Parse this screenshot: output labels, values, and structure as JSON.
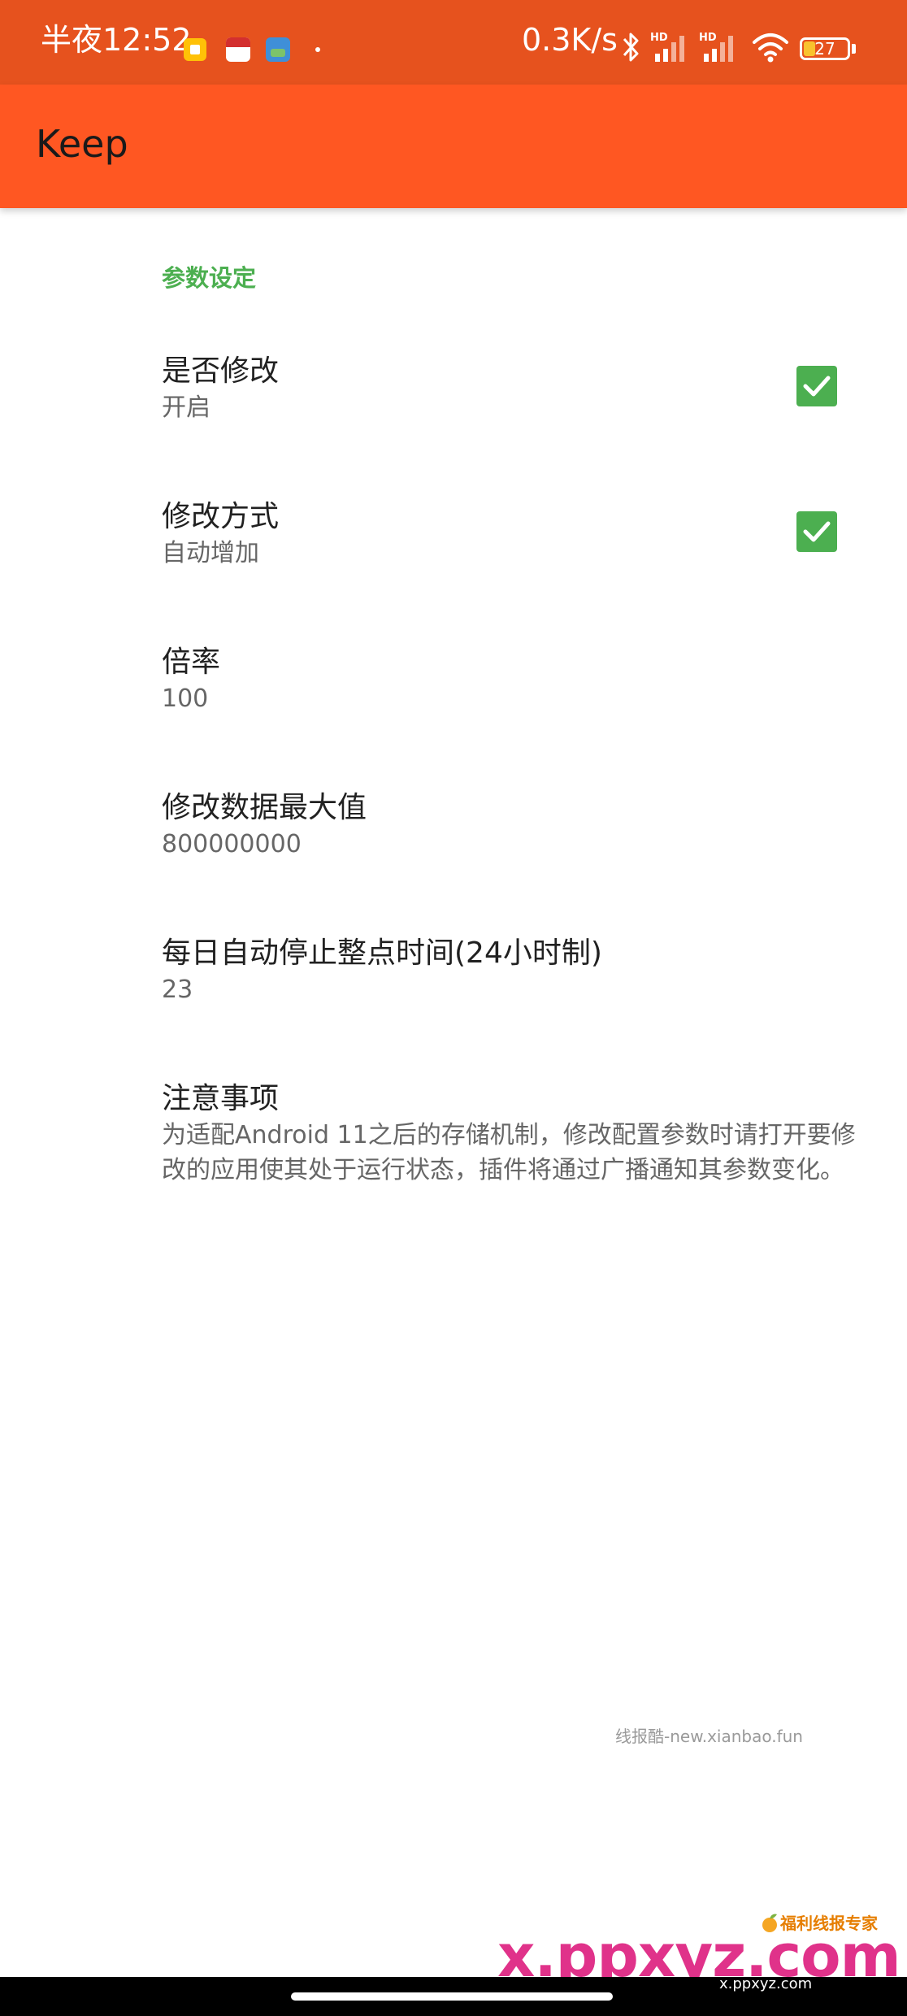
{
  "status_bar": {
    "time": "半夜12:52",
    "net_speed": "0.3K/s",
    "battery_level": "27",
    "battery_fraction": 0.27,
    "icons": [
      "bluetooth-icon",
      "hd-signal-icon",
      "hd-signal-icon",
      "wifi-icon",
      "battery-icon"
    ]
  },
  "app_bar": {
    "title": "Keep",
    "color": "#FF5722",
    "status_color": "#E6521E"
  },
  "preferences": {
    "category": "参数设定",
    "accent": "#4CAF50",
    "items": [
      {
        "title": "是否修改",
        "summary": "开启",
        "checked": true
      },
      {
        "title": "修改方式",
        "summary": "自动增加",
        "checked": true
      },
      {
        "title": "倍率",
        "summary": "100"
      },
      {
        "title": "修改数据最大值",
        "summary": "800000000"
      },
      {
        "title": "每日自动停止整点时间(24小时制)",
        "summary": "23"
      },
      {
        "title": "注意事项",
        "summary": "为适配Android 11之后的存储机制，修改配置参数时请打开要修改的应用使其处于运行状态，插件将通过广播通知其参数变化。"
      }
    ]
  },
  "watermarks": {
    "xianbao": "线报酷-new.xianbao.fun",
    "badge": "福利线报专家",
    "site": "x.ppxyz.com",
    "site_small": "x.ppxyz.com"
  }
}
